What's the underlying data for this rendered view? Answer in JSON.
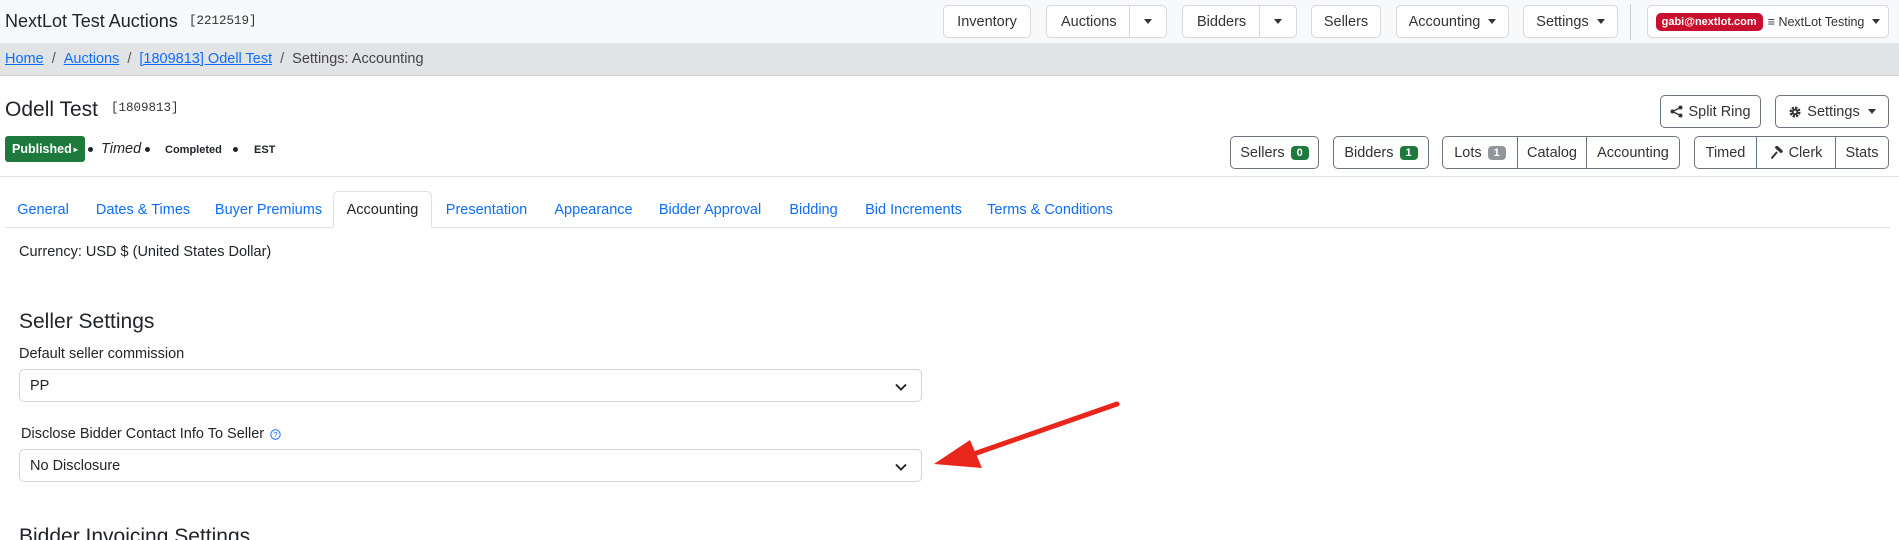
{
  "topbar": {
    "brand": "NextLot Test Auctions",
    "brand_id": "[2212519]",
    "nav": {
      "inventory": "Inventory",
      "auctions": "Auctions",
      "bidders": "Bidders",
      "sellers": "Sellers",
      "accounting": "Accounting",
      "settings": "Settings"
    },
    "user_email": "gabi@nextlot.com",
    "user_account": "≡ NextLot Testing"
  },
  "breadcrumb": {
    "home": "Home",
    "auctions": "Auctions",
    "auction": "[1809813] Odell Test",
    "current": "Settings: Accounting",
    "separator": "/"
  },
  "auction": {
    "title": "Odell Test",
    "id": "[1809813]",
    "status": "Published",
    "type": "Timed",
    "state": "Completed",
    "timezone": "EST"
  },
  "actions": {
    "split_ring": "Split Ring",
    "settings": "Settings",
    "sellers": "Sellers",
    "sellers_count": "0",
    "bidders": "Bidders",
    "bidders_count": "1",
    "lots": "Lots",
    "lots_count": "1",
    "catalog": "Catalog",
    "accounting": "Accounting",
    "timed": "Timed",
    "clerk": "Clerk",
    "stats": "Stats"
  },
  "tabs": [
    "General",
    "Dates & Times",
    "Buyer Premiums",
    "Accounting",
    "Presentation",
    "Appearance",
    "Bidder Approval",
    "Bidding",
    "Bid Increments",
    "Terms & Conditions"
  ],
  "active_tab": "Accounting",
  "content": {
    "currency": "Currency: USD $ (United States Dollar)",
    "seller_heading": "Seller Settings",
    "commission_label": "Default seller commission",
    "commission_value": "PP",
    "disclose_label": "Disclose Bidder Contact Info To Seller",
    "disclose_value": "No Disclosure",
    "bidder_heading": "Bidder Invoicing Settings"
  },
  "colors": {
    "link": "#0d6efd",
    "published": "#1e7a3c",
    "user_badge": "#c8102e",
    "annotation_arrow": "#e8261c"
  }
}
